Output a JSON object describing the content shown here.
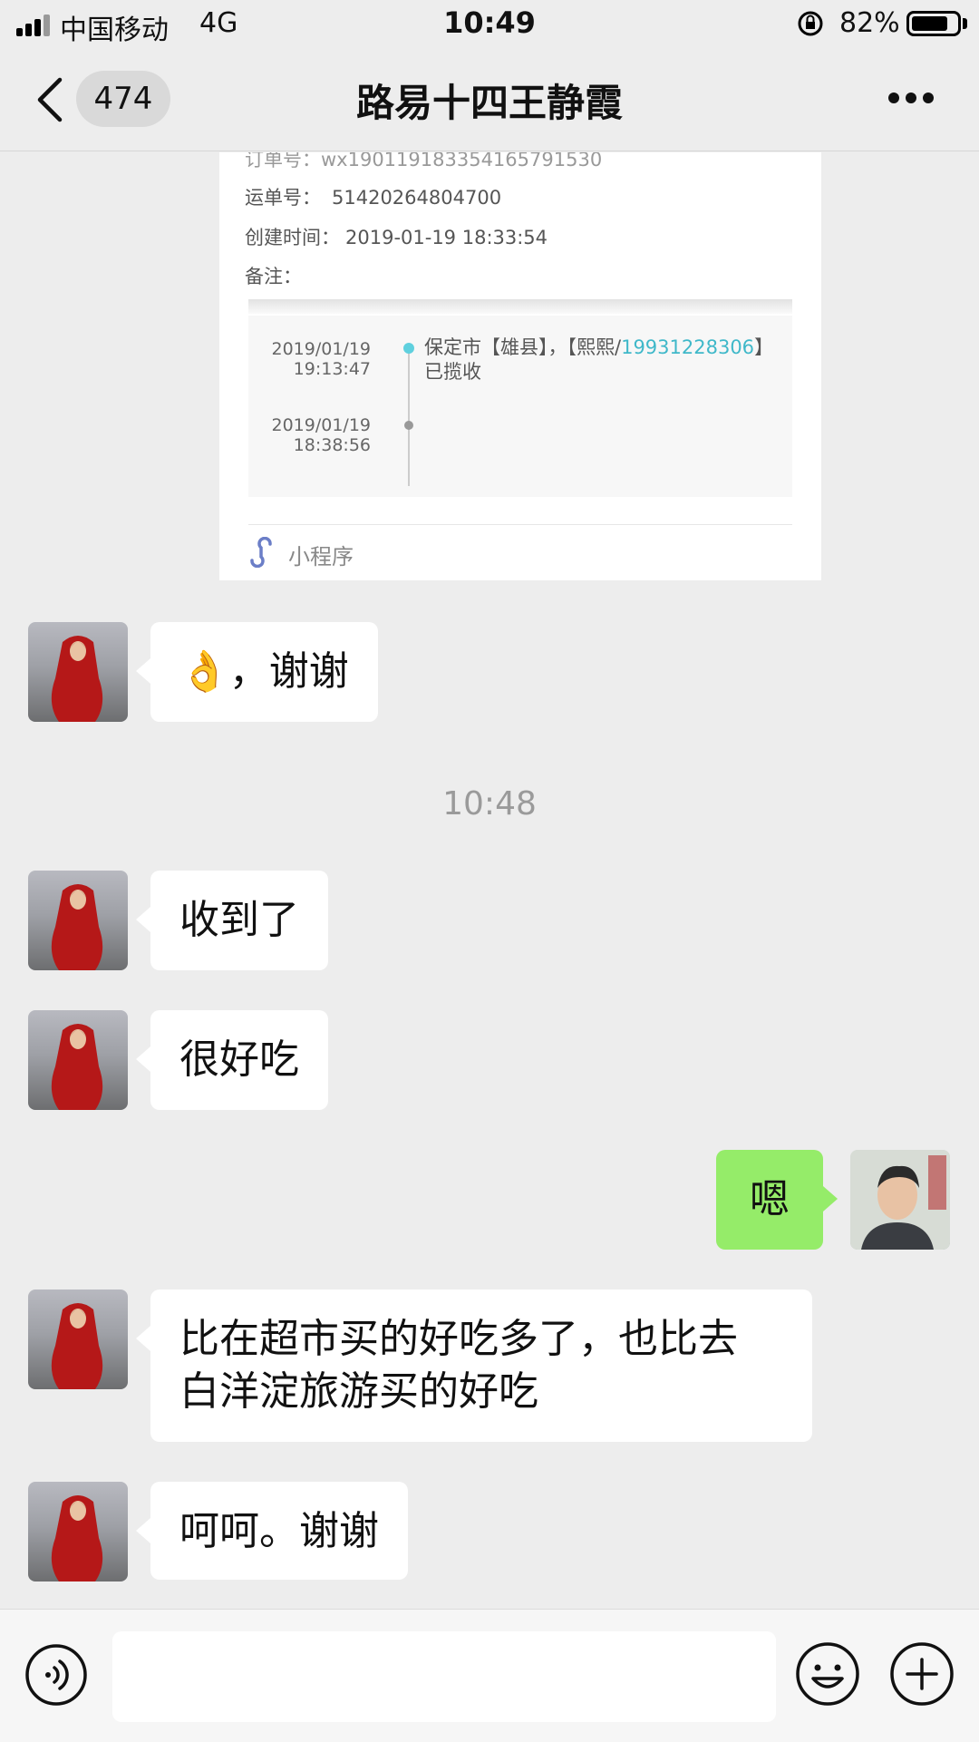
{
  "status_bar": {
    "carrier": "中国移动",
    "network": "4G",
    "time": "10:49",
    "battery_percent": "82%",
    "battery_level": 0.82
  },
  "nav": {
    "unread_count": "474",
    "title": "路易十四王静霞"
  },
  "mini_program_card": {
    "order_label_cut": "订单号：wx190119183354165791530",
    "waybill_label": "运单号：",
    "waybill_no": "51420264804700",
    "created_label": "创建时间：",
    "created_time": "2019-01-19 18:33:54",
    "remark_label": "备注：",
    "tracking": [
      {
        "date": "2019/01/19",
        "time": "19:13:47",
        "text_prefix": "保定市【雄县】，【熙熙/",
        "phone": "19931228306",
        "text_suffix": "】",
        "text_line2": "已揽收"
      },
      {
        "date": "2019/01/19",
        "time": "18:38:56"
      }
    ],
    "footer_label": "小程序",
    "accent_color": "#3fb8c9"
  },
  "messages": [
    {
      "side": "in",
      "emoji": "👌",
      "text": "，谢谢"
    },
    {
      "side": "in",
      "text": "收到了"
    },
    {
      "side": "in",
      "text": "很好吃"
    },
    {
      "side": "out",
      "text": "嗯"
    },
    {
      "side": "in",
      "line1": "比在超市买的好吃多了，也比去",
      "line2": "白洋淀旅游买的好吃"
    },
    {
      "side": "in",
      "text": "呵呵。谢谢"
    }
  ],
  "timestamp": "10:48",
  "colors": {
    "background": "#ededed",
    "outgoing_bubble": "#95ec69",
    "incoming_bubble": "#ffffff"
  },
  "input_bar": {
    "icons": [
      "voice-icon",
      "emoji-icon",
      "plus-icon"
    ],
    "input_value": ""
  }
}
